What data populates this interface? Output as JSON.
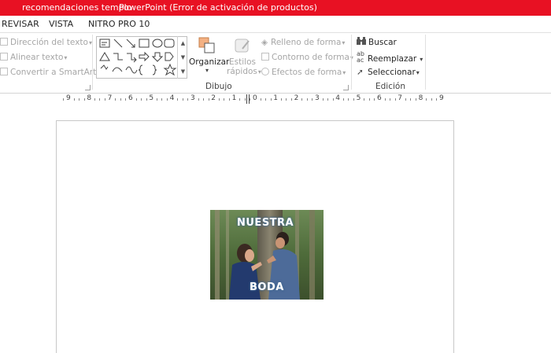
{
  "titlebar": {
    "filename": "recomendaciones templo",
    "app": "PowerPoint (Error de activación de productos)",
    "color": "#e81123"
  },
  "tabs": [
    "REVISAR",
    "VISTA",
    "NITRO PRO 10"
  ],
  "ribbon": {
    "paragraph_group": {
      "text_direction": "Dirección del texto",
      "align_text": "Alinear texto",
      "convert_smartart": "Convertir a SmartArt"
    },
    "drawing_group": {
      "label": "Dibujo",
      "arrange": "Organizar",
      "quick_styles_1": "Estilos",
      "quick_styles_2": "rápidos",
      "shape_fill": "Relleno de forma",
      "shape_outline": "Contorno de forma",
      "shape_effects": "Efectos de forma"
    },
    "editing_group": {
      "label": "Edición",
      "find": "Buscar",
      "replace": "Reemplazar",
      "select": "Seleccionar"
    }
  },
  "ruler": {
    "labels": [
      "9",
      "8",
      "7",
      "6",
      "5",
      "4",
      "3",
      "2",
      "1",
      "0",
      "1",
      "2",
      "3",
      "4",
      "5",
      "6",
      "7",
      "8",
      "9"
    ]
  },
  "slide": {
    "image": {
      "text_top": "NUESTRA",
      "text_bottom": "BODA"
    }
  }
}
